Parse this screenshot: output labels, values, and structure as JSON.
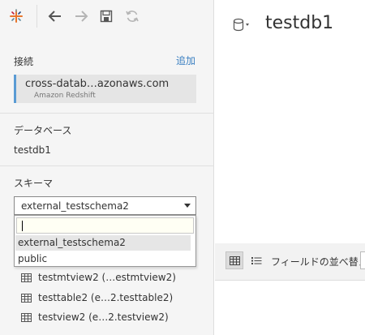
{
  "toolbar": {
    "logo_icon": "tableau-logo-icon",
    "back_icon": "back-arrow-icon",
    "forward_icon": "forward-arrow-icon",
    "save_icon": "save-icon",
    "refresh_icon": "refresh-icon"
  },
  "connection": {
    "label": "接続",
    "add_label": "追加",
    "name": "cross-datab…azonaws.com",
    "type": "Amazon Redshift"
  },
  "database": {
    "label": "データベース",
    "value": "testdb1"
  },
  "schema": {
    "label": "スキーマ",
    "selected": "external_testschema2",
    "search_value": "",
    "options": [
      "external_testschema2",
      "public"
    ]
  },
  "tables": [
    {
      "label": "testmtview2 (…estmtview2)"
    },
    {
      "label": "testtable2 (e…2.testtable2)"
    },
    {
      "label": "testview2 (e…2.testview2)"
    }
  ],
  "main": {
    "title": "testdb1",
    "sort_label": "フィールドの並べ替え"
  },
  "colors": {
    "accent": "#5a9bd4",
    "link": "#3a7fc1",
    "panel_bg": "#f5f5f5"
  }
}
